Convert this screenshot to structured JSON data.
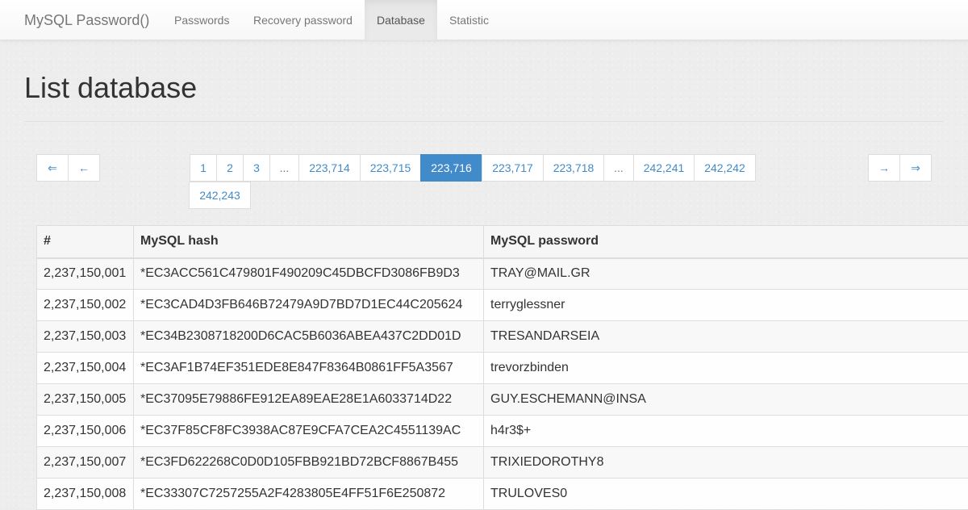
{
  "navbar": {
    "brand": "MySQL Password()",
    "items": [
      {
        "label": "Passwords"
      },
      {
        "label": "Recovery password"
      },
      {
        "label": "Database",
        "active": true
      },
      {
        "label": "Statistic"
      }
    ]
  },
  "page": {
    "title": "List database"
  },
  "pagination": {
    "first": "⇐",
    "prev": "←",
    "next": "→",
    "last": "⇒",
    "pages": [
      "1",
      "2",
      "3",
      "...",
      "223,714",
      "223,715",
      "223,716",
      "223,717",
      "223,718",
      "...",
      "242,241",
      "242,242",
      "242,243"
    ],
    "current": "223,716"
  },
  "table": {
    "headers": [
      "#",
      "MySQL hash",
      "MySQL password"
    ],
    "rows": [
      [
        "2,237,150,001",
        "*EC3ACC561C479801F490209C45DBCFD3086FB9D3",
        "TRAY@MAIL.GR"
      ],
      [
        "2,237,150,002",
        "*EC3CAD4D3FB646B72479A9D7BD7D1EC44C205624",
        "terryglessner"
      ],
      [
        "2,237,150,003",
        "*EC34B2308718200D6CAC5B6036ABEA437C2DD01D",
        "TRESANDARSEIA"
      ],
      [
        "2,237,150,004",
        "*EC3AF1B74EF351EDE8E847F8364B0861FF5A3567",
        "trevorzbinden"
      ],
      [
        "2,237,150,005",
        "*EC37095E79886FE912EA89EAE28E1A6033714D22",
        "GUY.ESCHEMANN@INSA"
      ],
      [
        "2,237,150,006",
        "*EC37F85CF8FC3938AC87E9CFA7CEA2C4551139AC",
        "h4r3$+"
      ],
      [
        "2,237,150,007",
        "*EC3FD622268C0D0D105FBB921BD72BCF8867B455",
        "TRIXIEDOROTHY8"
      ],
      [
        "2,237,150,008",
        "*EC33307C7257255A2F4283805E4FF51F6E250872",
        "TRULOVES0"
      ]
    ]
  },
  "colors": {
    "link": "#428bca",
    "active_page_bg": "#428bca",
    "navbar_bg": "#f8f8f8"
  }
}
